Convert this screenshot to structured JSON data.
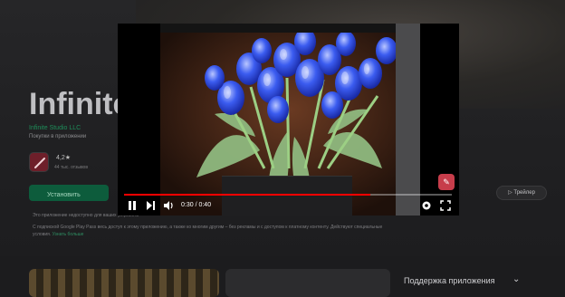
{
  "app": {
    "title": "Infinite I",
    "developer": "Infinite Studio LLC",
    "developer_sub": "Покупки в приложении",
    "rating": "4,2★",
    "rating_sub": "44 тыс. отзывов",
    "install_label": "Установить",
    "note_1": "Это приложение недоступно для ваших устройств",
    "note_2": "С подпиской Google Play Pass весь доступ к этому приложению, а также ко многим другим – без рекламы и с доступом к платному контенту. Действуют специальные",
    "note_3_prefix": "условия.",
    "note_3_link": "Узнать больше",
    "trailer_label": "▷ Трейлер"
  },
  "support": {
    "label": "Поддержка приложения",
    "chevron": "⌄"
  },
  "player": {
    "time_label": "0:30 / 0:40",
    "progress_fraction": 0.75,
    "icons": {
      "play_pause": "pause-icon",
      "next": "next-icon",
      "volume": "volume-icon",
      "settings": "gear-icon",
      "fullscreen": "fullscreen-icon"
    }
  },
  "colors": {
    "accent_red": "#ff0000",
    "brand_green": "#1e8e5a",
    "fab_red": "#c73d4b"
  }
}
